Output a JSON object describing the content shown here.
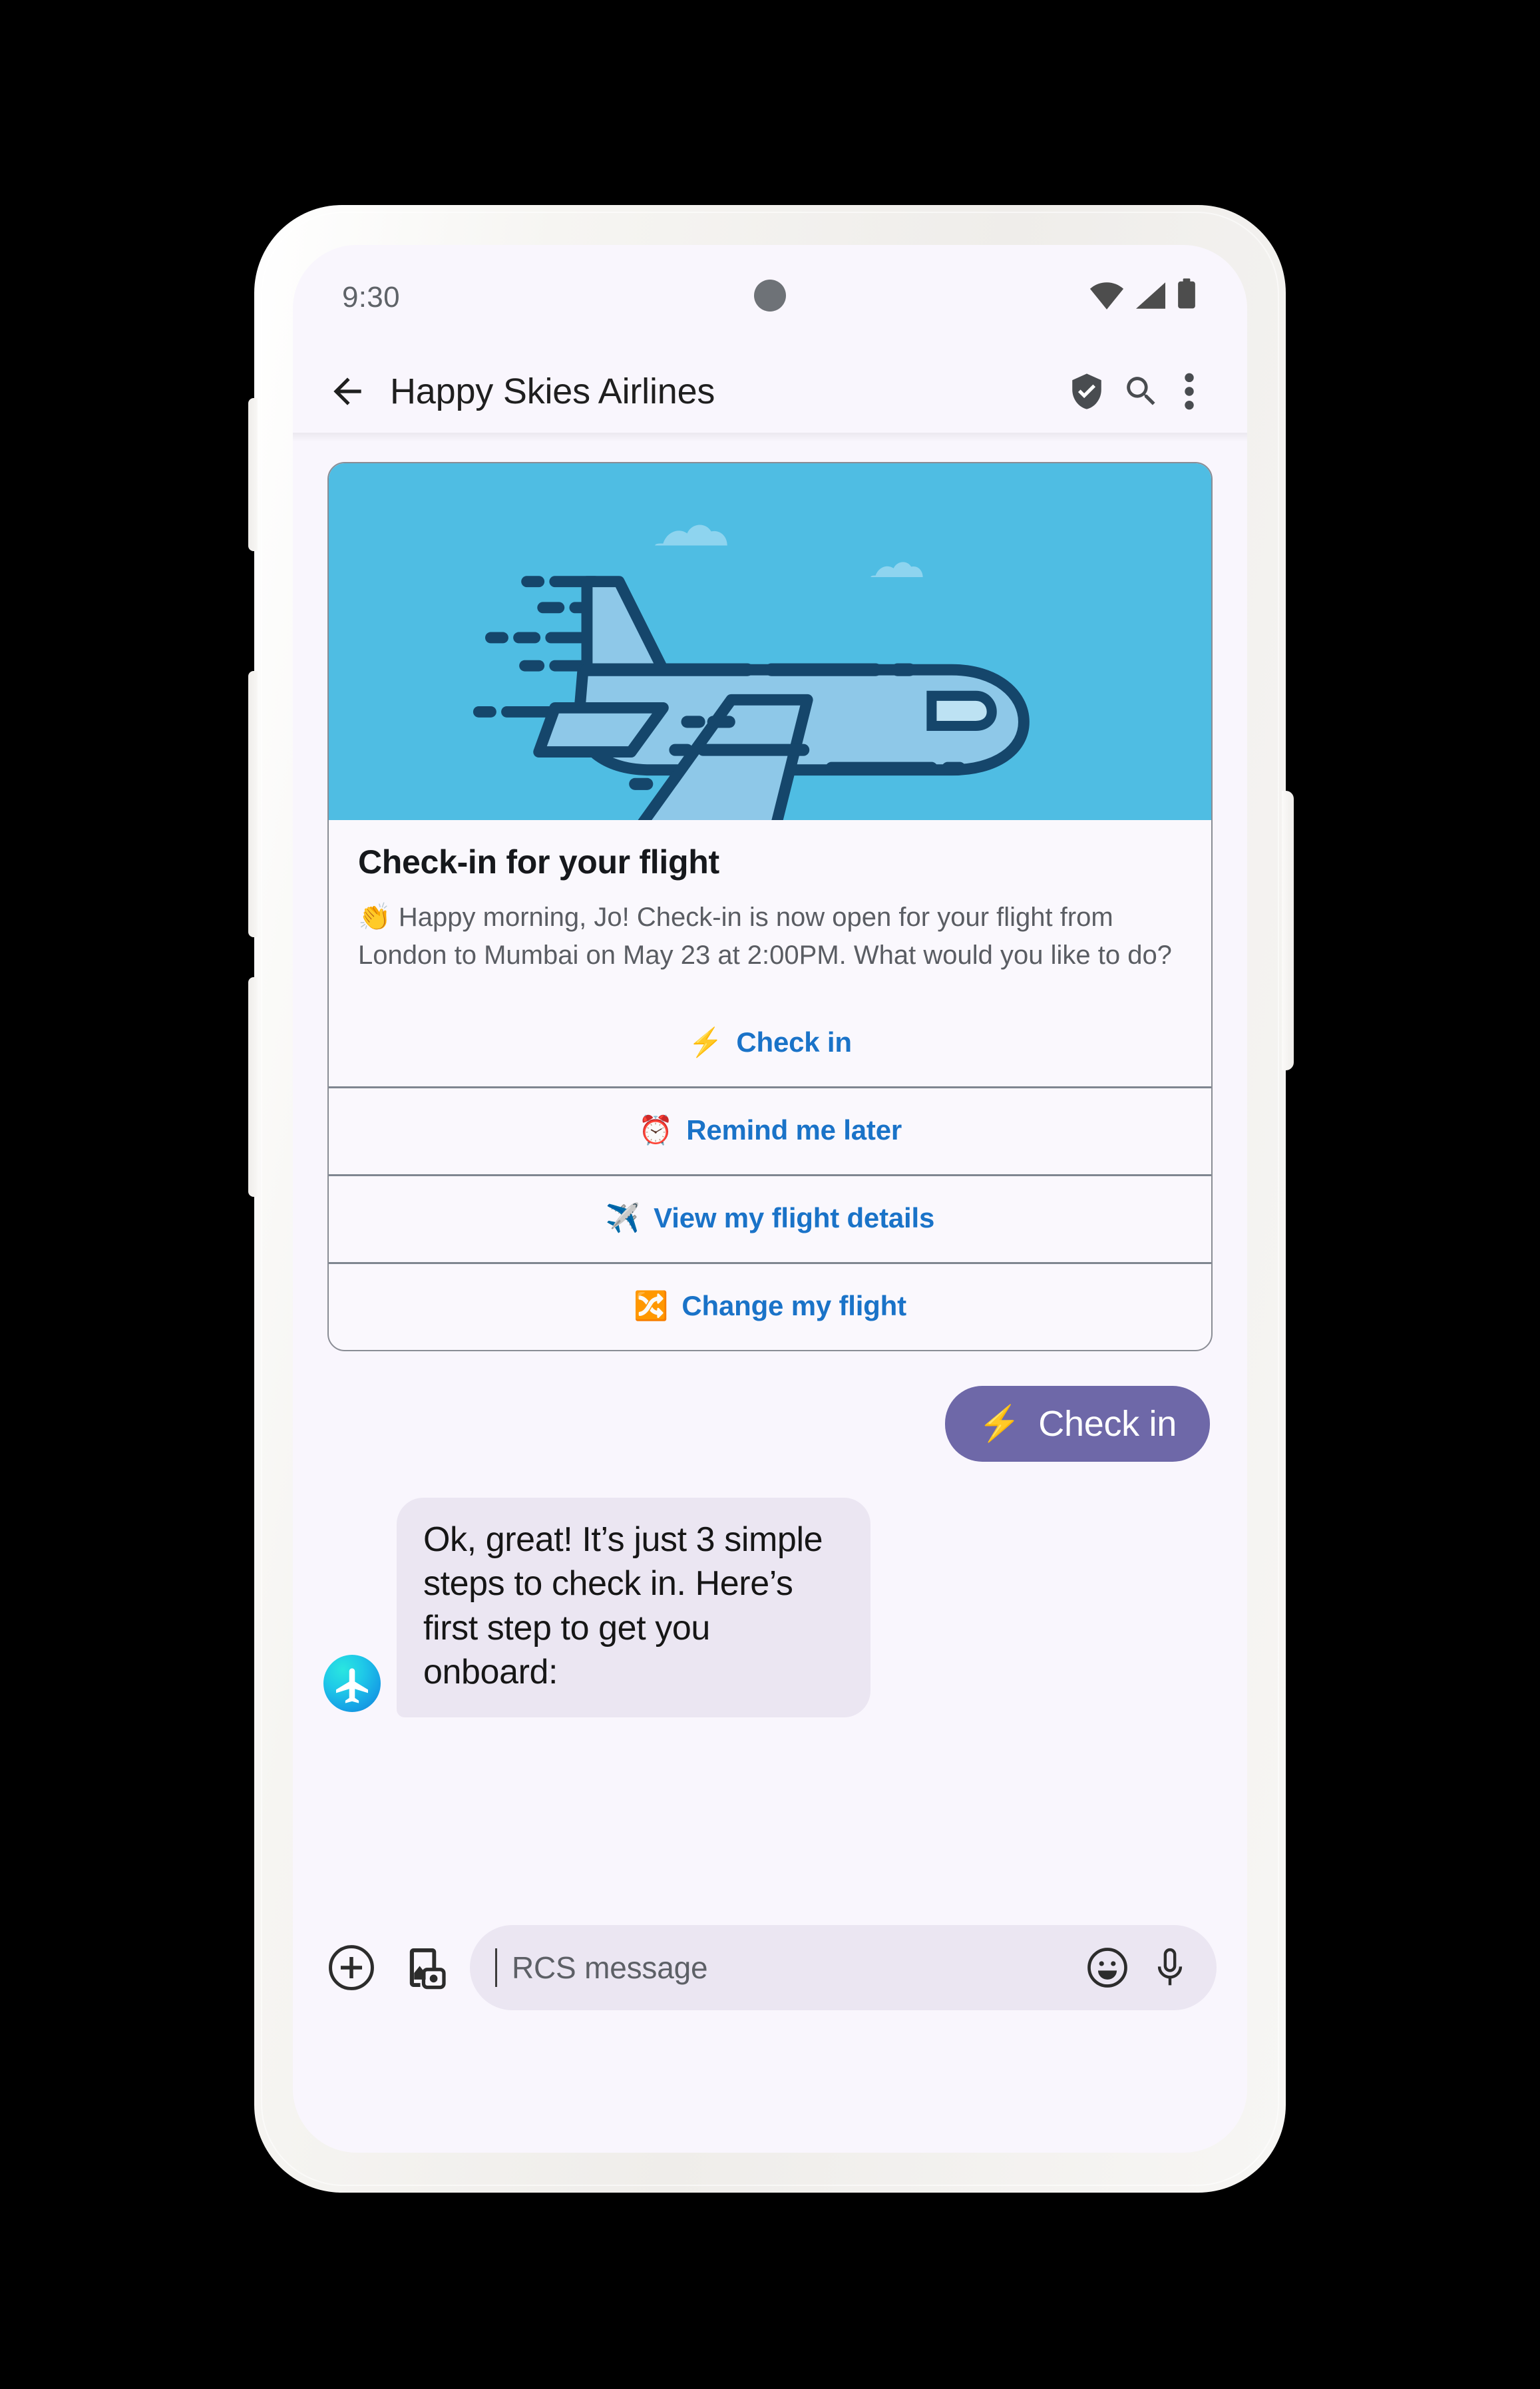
{
  "status_bar": {
    "time": "9:30",
    "icons": [
      "wifi-icon",
      "cellular-signal-icon",
      "battery-icon"
    ]
  },
  "app_bar": {
    "back_icon": "back-arrow-icon",
    "title": "Happy Skies Airlines",
    "verified_icon": "verified-shield-icon",
    "search_icon": "search-icon",
    "overflow_icon": "more-vertical-icon"
  },
  "rich_card": {
    "media_icon": "airplane-illustration",
    "title": "Check-in for your flight",
    "description": "👏 Happy morning, Jo! Check-in is now open for your flight from London to Mumbai on May 23 at 2:00PM. What would you like to do?",
    "actions": [
      {
        "emoji": "⚡",
        "label": "Check in",
        "icon": "high-voltage-icon"
      },
      {
        "emoji": "⏰",
        "label": "Remind me later",
        "icon": "alarm-clock-icon"
      },
      {
        "emoji": "✈️",
        "label": "View my flight details",
        "icon": "airplane-icon"
      },
      {
        "emoji": "🔀",
        "label": "Change my flight",
        "icon": "shuffle-icon"
      }
    ]
  },
  "sent_message": {
    "emoji": "⚡",
    "label": "Check in"
  },
  "received_message": {
    "avatar_icon": "airline-avatar-icon",
    "text": "Ok, great! It’s just 3 simple steps to check in. Here’s first step to get you onboard:"
  },
  "compose_bar": {
    "add_icon": "plus-circle-icon",
    "gallery_icon": "gallery-camera-icon",
    "placeholder": "RCS message",
    "emoji_icon": "emoji-face-icon",
    "mic_icon": "microphone-icon"
  },
  "colors": {
    "screen_background": "#f9f6fd",
    "card_media_background": "#4fbde3",
    "action_link": "#1a73c8",
    "sent_bubble": "#6e68a8",
    "received_bubble": "#ebe6f2",
    "divider": "#7f8690",
    "card_border": "#8a8d95"
  }
}
